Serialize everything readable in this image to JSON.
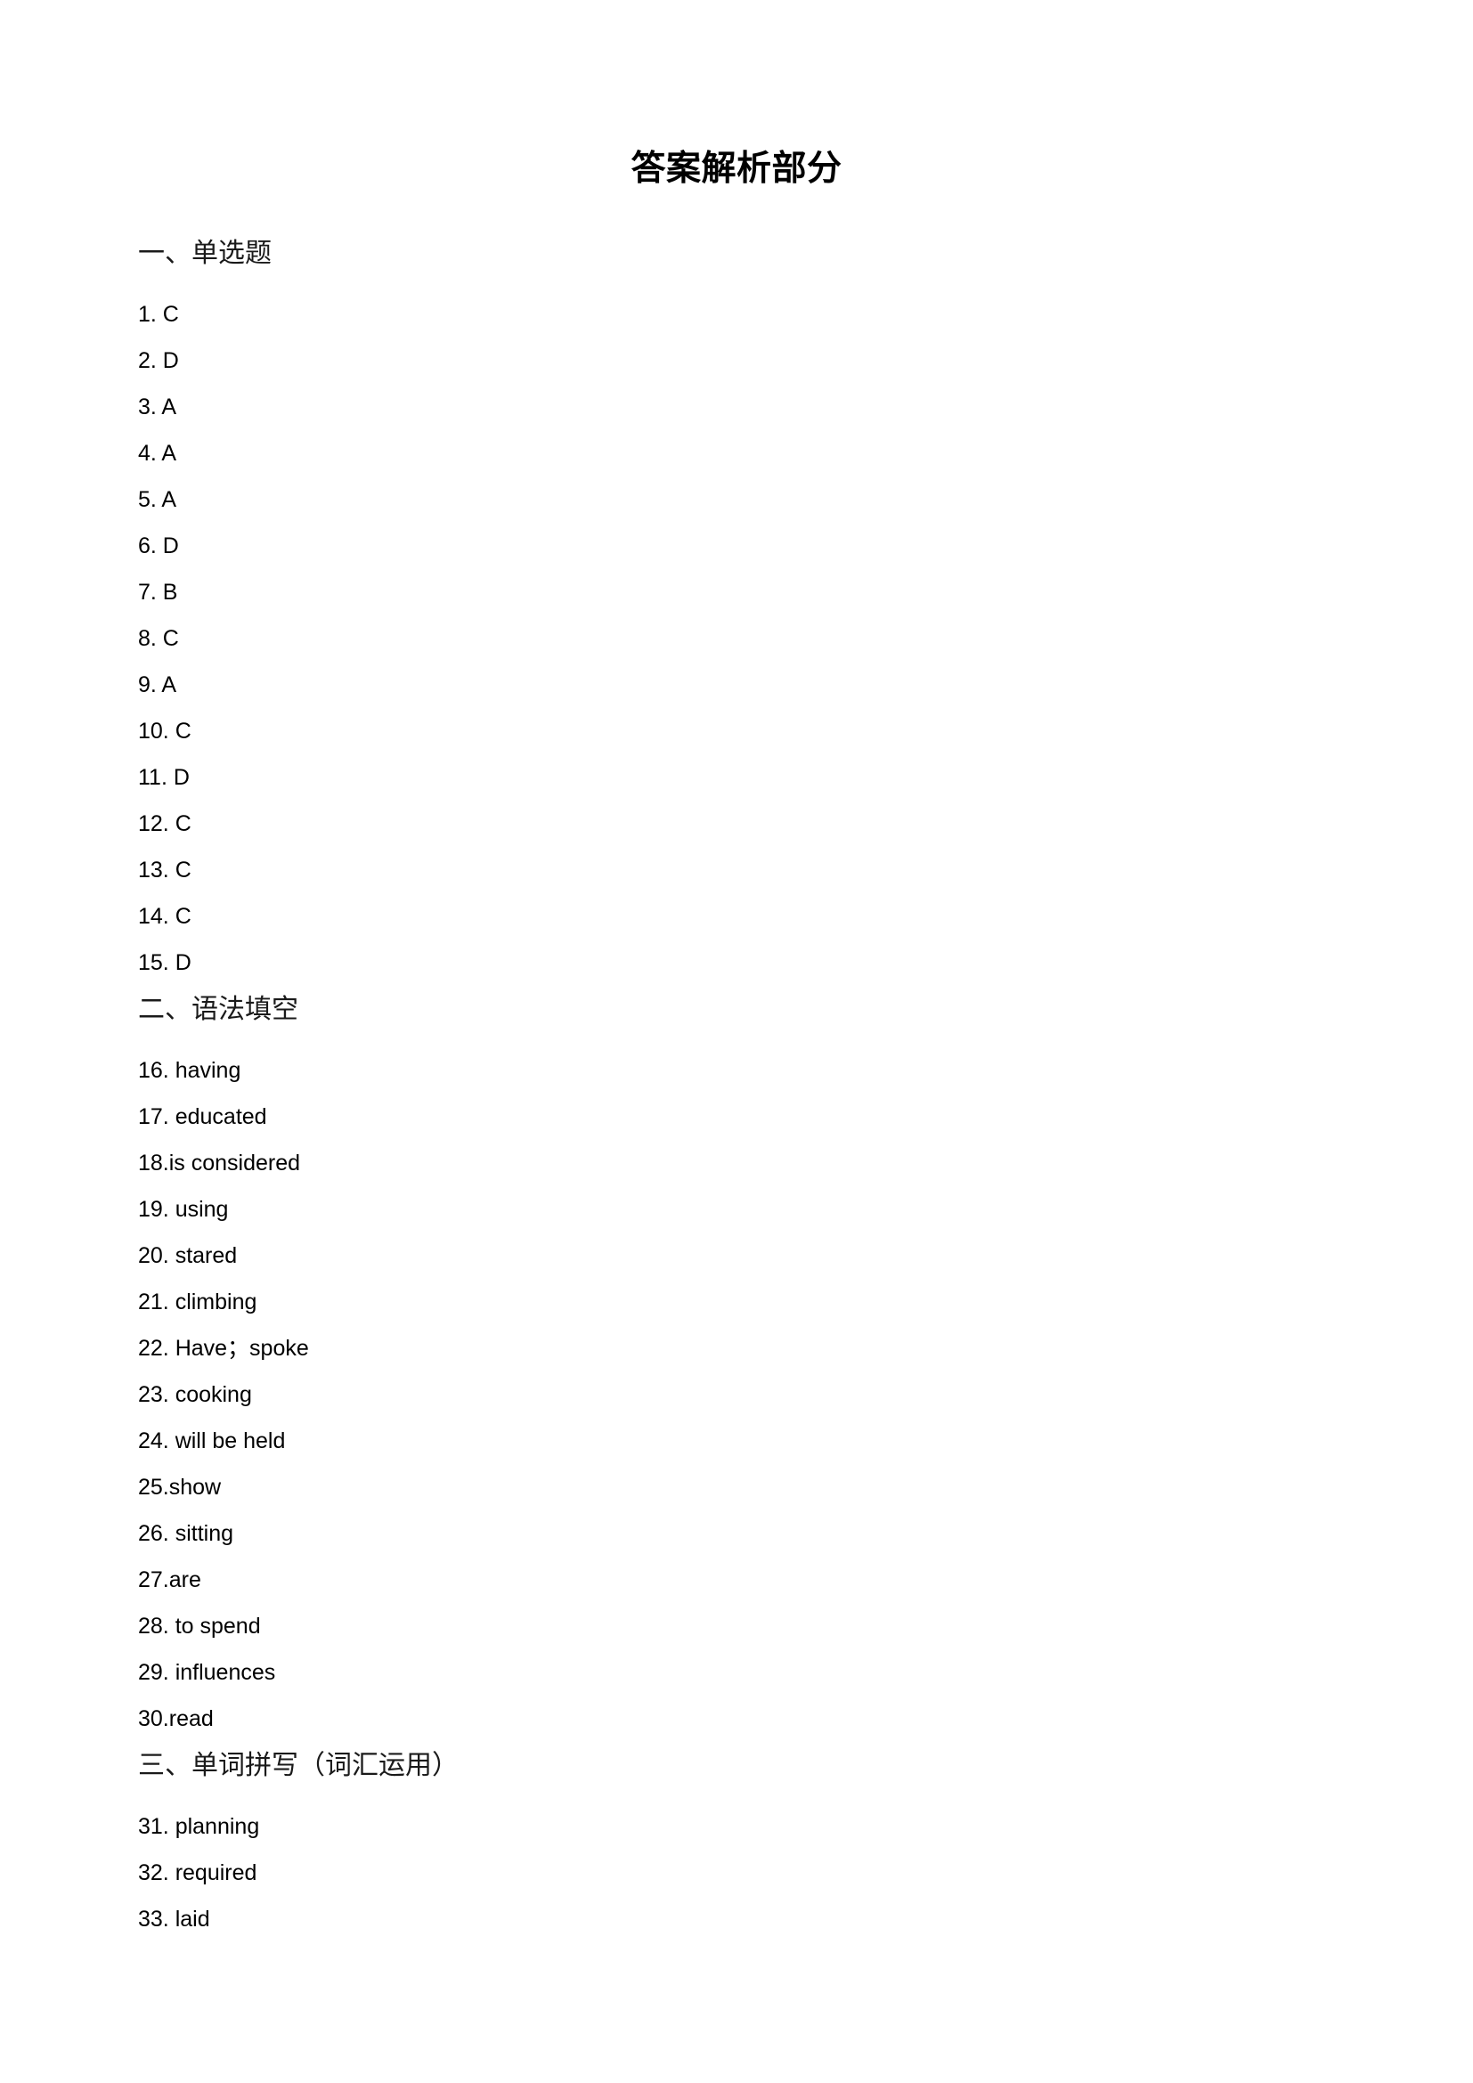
{
  "document": {
    "title": "答案解析部分"
  },
  "sections": [
    {
      "heading": "一、单选题",
      "items": [
        "1. C",
        "2. D",
        "3. A",
        "4. A",
        "5. A",
        "6. D",
        "7. B",
        "8. C",
        "9. A",
        "10. C",
        "11. D",
        "12. C",
        "13. C",
        "14. C",
        "15. D"
      ]
    },
    {
      "heading": "二、语法填空",
      "items": [
        "16. having",
        "17. educated",
        "18.is considered",
        "19. using",
        "20. stared",
        "21. climbing",
        "22. Have；spoke",
        "23. cooking",
        "24. will be held",
        "25.show",
        "26. sitting",
        "27.are",
        "28. to spend",
        "29. influences",
        "30.read"
      ]
    },
    {
      "heading": "三、单词拼写（词汇运用）",
      "items": [
        "31. planning",
        "32. required",
        "33. laid"
      ]
    }
  ]
}
